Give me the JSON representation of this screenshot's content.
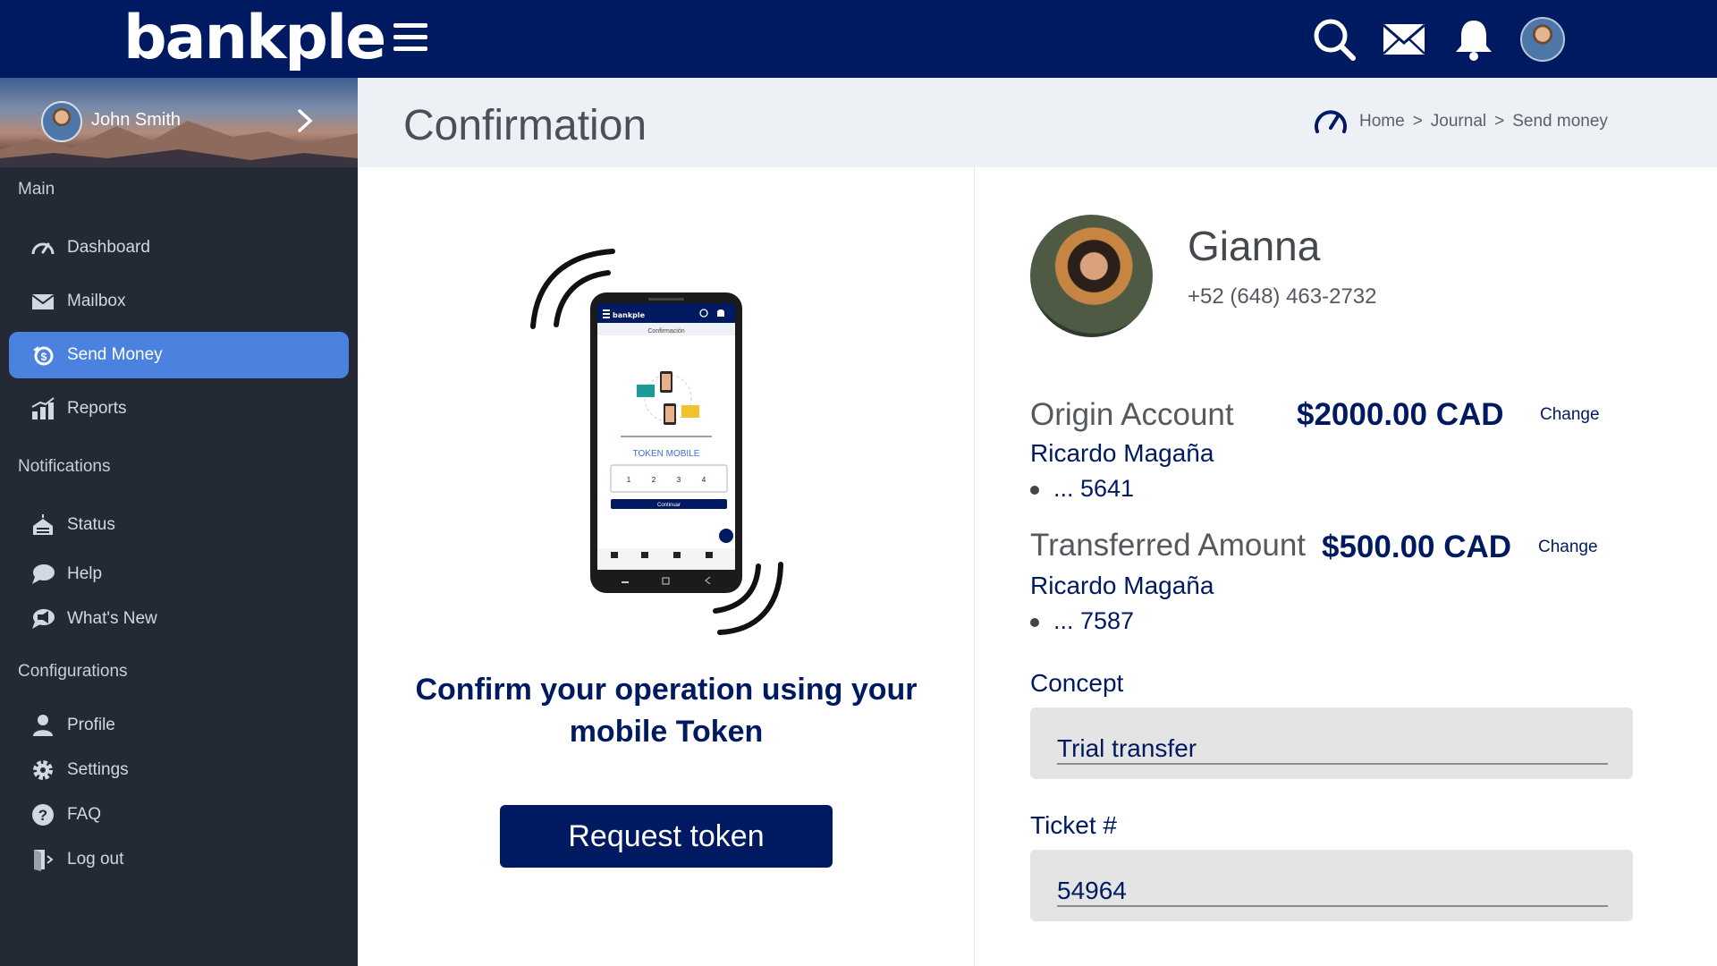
{
  "brand": {
    "logo_text": "bankple"
  },
  "header": {
    "icons": [
      "menu-icon",
      "search-icon",
      "mail-icon",
      "bell-icon"
    ]
  },
  "sidebar": {
    "user_name": "John Smith",
    "sections": {
      "main": "Main",
      "notifications": "Notifications",
      "configurations": "Configurations"
    },
    "items": [
      {
        "label": "Dashboard",
        "icon": "speedometer-icon"
      },
      {
        "label": "Mailbox",
        "icon": "mail-icon"
      },
      {
        "label": "Send Money",
        "icon": "send-money-icon",
        "active": true
      },
      {
        "label": "Reports",
        "icon": "chart-icon"
      },
      {
        "label": "Status",
        "icon": "status-icon"
      },
      {
        "label": "Help",
        "icon": "chat-bubble-icon"
      },
      {
        "label": "What's New",
        "icon": "megaphone-icon"
      },
      {
        "label": "Profile",
        "icon": "user-icon"
      },
      {
        "label": "Settings",
        "icon": "gear-icon"
      },
      {
        "label": "FAQ",
        "icon": "question-icon"
      },
      {
        "label": "Log out",
        "icon": "logout-icon"
      }
    ],
    "active_color": "#4b82e0"
  },
  "page": {
    "title": "Confirmation",
    "breadcrumb": [
      "Home",
      "Journal",
      "Send money"
    ],
    "breadcrumb_separator": ">"
  },
  "token_panel": {
    "phone_screen": {
      "app_title": "Confirmación",
      "token_label": "TOKEN MOBILE",
      "digits": [
        "1",
        "2",
        "3",
        "4"
      ],
      "continue_label": "Continuar"
    },
    "message": "Confirm your operation using your mobile Token",
    "button_label": "Request token"
  },
  "recipient": {
    "name": "Gianna",
    "phone": "+52 (648) 463-2732"
  },
  "origin_account": {
    "label": "Origin Account",
    "amount": "$2000.00 CAD",
    "change_label": "Change",
    "holder": "Ricardo Magaña",
    "number": "... 5641"
  },
  "transferred": {
    "label": "Transferred Amount",
    "amount": "$500.00 CAD",
    "change_label": "Change",
    "holder": "Ricardo Magaña",
    "number": "... 7587"
  },
  "concept": {
    "label": "Concept",
    "value": "Trial transfer"
  },
  "ticket": {
    "label": "Ticket #",
    "value": "54964"
  },
  "colors": {
    "navy": "#001a61",
    "sidebar_bg": "#232a36",
    "header_bg": "#edf1f6"
  }
}
